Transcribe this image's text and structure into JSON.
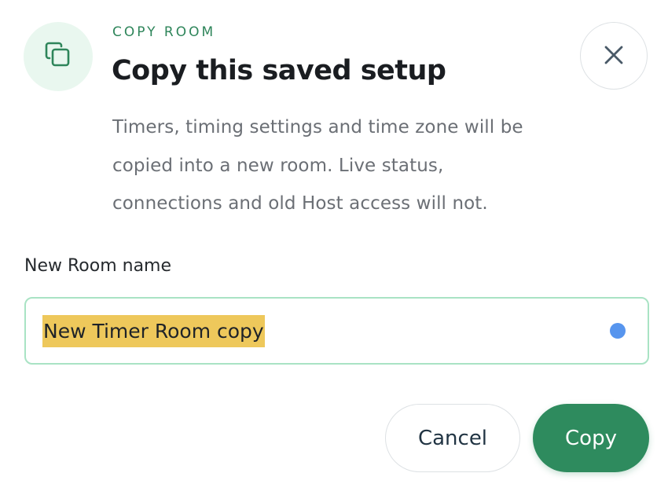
{
  "dialog": {
    "eyebrow": "COPY ROOM",
    "title": "Copy this saved setup",
    "description": "Timers, timing settings and time zone will be copied into a new room. Live status, connections and old Host access will not.",
    "header_icon": "copy-icon",
    "close_icon": "close-icon"
  },
  "form": {
    "room_name_label": "New Room name",
    "room_name_value": "New Timer Room copy",
    "room_name_selected": true
  },
  "actions": {
    "cancel_label": "Cancel",
    "copy_label": "Copy"
  },
  "colors": {
    "accent": "#2e8b5e",
    "accent_soft": "#e9f7ef",
    "input_border": "#a9e3c4",
    "selection_highlight": "#eec85b",
    "indicator_dot": "#5795ee"
  }
}
